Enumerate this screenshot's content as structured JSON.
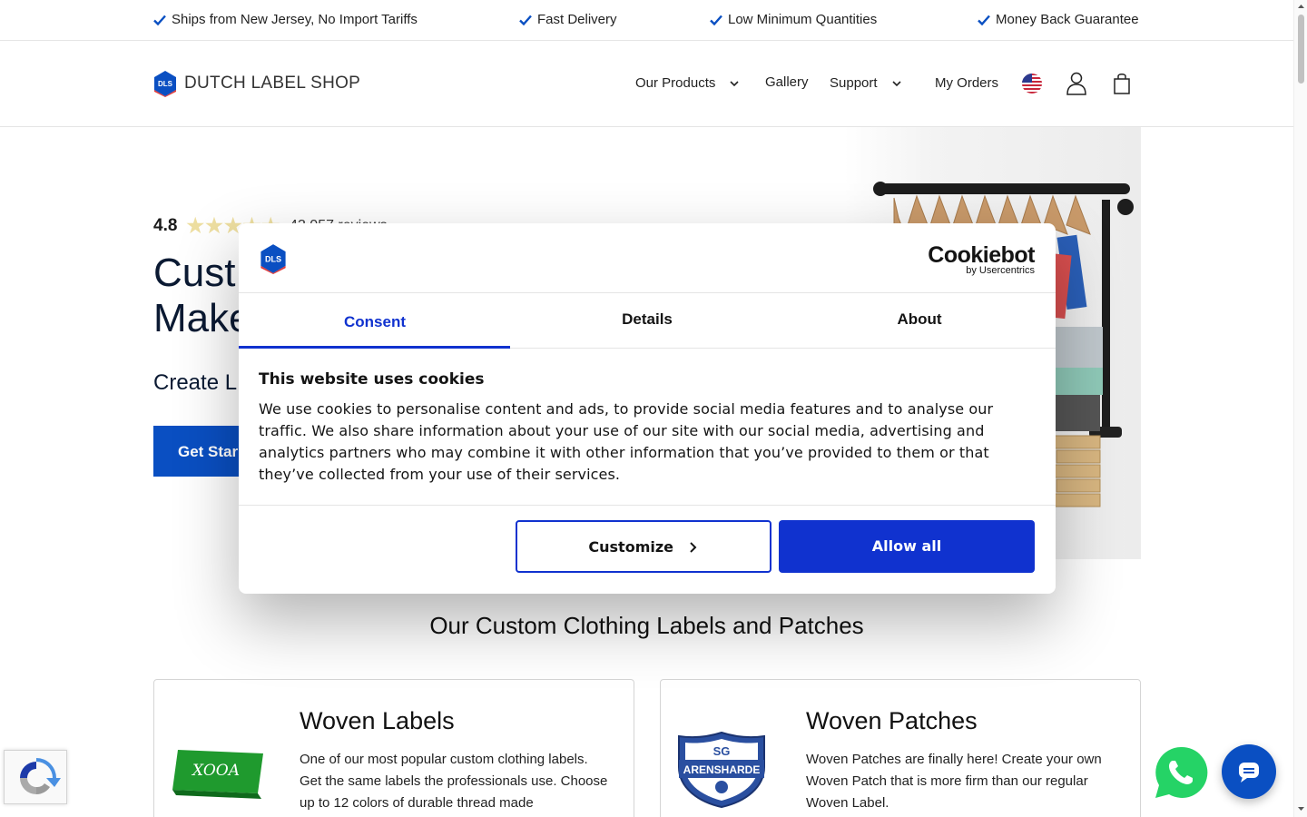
{
  "topbar": {
    "usps": [
      "Ships from New Jersey, No Import Tariffs",
      "Fast Delivery",
      "Low Minimum Quantities",
      "Money Back Guarantee"
    ]
  },
  "header": {
    "logo_badge": "DLS",
    "logo_text": "DUTCH LABEL SHOP",
    "nav": {
      "products": "Our Products",
      "gallery": "Gallery",
      "support": "Support",
      "orders": "My Orders"
    }
  },
  "hero": {
    "rating": "4.8",
    "stars": "★★★★★",
    "reviews": "43,057 reviews",
    "title_line1": "Cust",
    "title_line2": "Make",
    "subtitle": "Create L",
    "cta": "Get Star"
  },
  "section": {
    "title": "Our Custom Clothing Labels and Patches"
  },
  "cards": [
    {
      "title": "Woven Labels",
      "text": "One of our most popular custom clothing labels. Get the same labels the professionals use. Choose up to 12 colors of durable thread made"
    },
    {
      "title": "Woven Patches",
      "text": "Woven Patches are finally here! Create your own Woven Patch that is more firm than our regular Woven Label.",
      "badge_top": "SG",
      "badge_name": "ARENSHARDE"
    }
  ],
  "cookie_modal": {
    "logo_badge": "DLS",
    "brand": "Cookiebot",
    "brand_sub": "by Usercentrics",
    "tabs": [
      "Consent",
      "Details",
      "About"
    ],
    "active_tab": "Consent",
    "title": "This website uses cookies",
    "body": "We use cookies to personalise content and ads, to provide social media features and to analyse our traffic. We also share information about your use of our site with our social media, advertising and analytics partners who may combine it with other information that you’ve provided to them or that they’ve collected from your use of their services.",
    "customize": "Customize",
    "allow_all": "Allow all"
  },
  "colors": {
    "primary_blue": "#0a4fc2",
    "cookiebot_blue": "#1032cf",
    "check_blue": "#0a4fc2"
  }
}
